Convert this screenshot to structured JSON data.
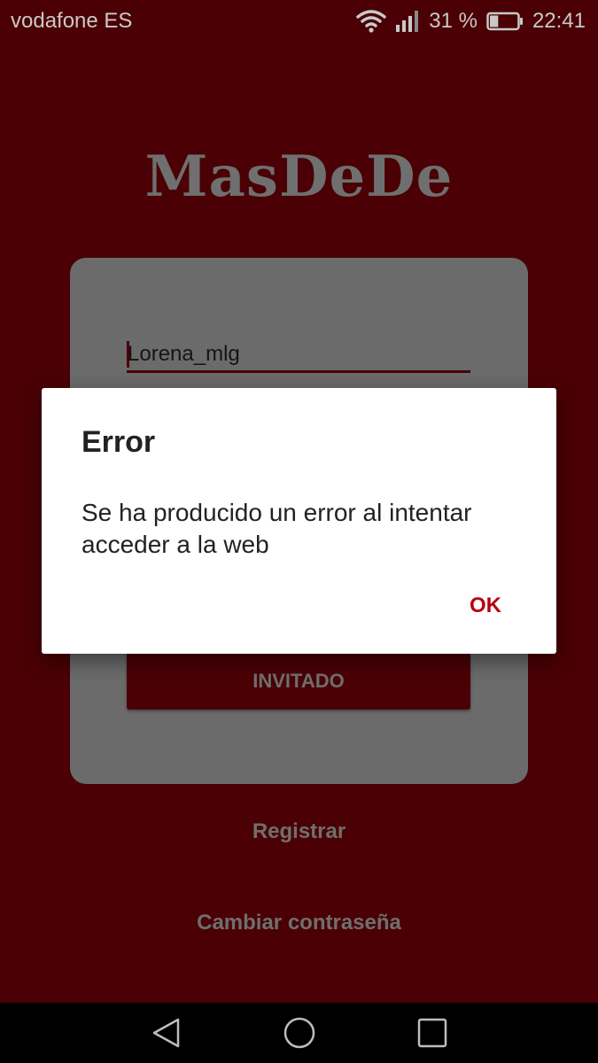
{
  "status_bar": {
    "carrier": "vodafone ES",
    "battery_percent": "31 %",
    "battery_level": 0.31,
    "time": "22:41",
    "icons": [
      "wifi-icon",
      "signal-icon",
      "battery-icon"
    ]
  },
  "app": {
    "logo": "MasDeDe",
    "username_value": "Lorena_mlg",
    "guest_button_label": "INVITADO",
    "register_link": "Registrar",
    "change_password_link": "Cambiar contraseña"
  },
  "dialog": {
    "title": "Error",
    "message": "Se ha producido un error al intentar acceder a la web",
    "ok_label": "OK"
  },
  "nav_bar": {
    "icons": [
      "back-icon",
      "home-icon",
      "recents-icon"
    ]
  },
  "colors": {
    "background": "#4a0004",
    "accent": "#b80010",
    "card": "#6b6b6b",
    "dim_text": "#6f6f6f"
  }
}
